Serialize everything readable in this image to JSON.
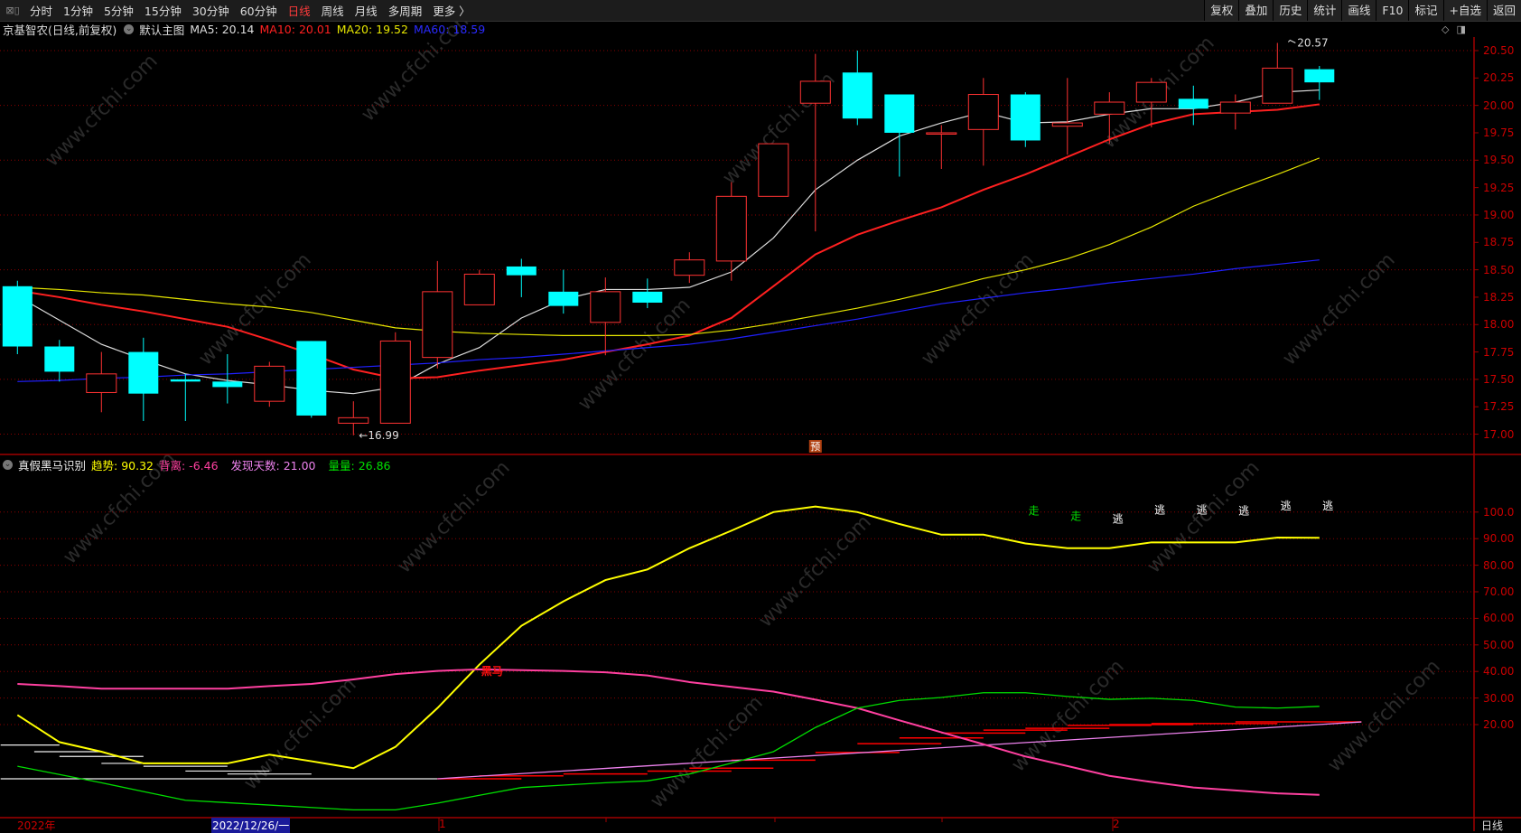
{
  "toolbar": {
    "periods": [
      {
        "label": "分时",
        "active": false
      },
      {
        "label": "1分钟",
        "active": false
      },
      {
        "label": "5分钟",
        "active": false
      },
      {
        "label": "15分钟",
        "active": false
      },
      {
        "label": "30分钟",
        "active": false
      },
      {
        "label": "60分钟",
        "active": false
      },
      {
        "label": "日线",
        "active": true
      },
      {
        "label": "周线",
        "active": false
      },
      {
        "label": "月线",
        "active": false
      },
      {
        "label": "多周期",
        "active": false
      },
      {
        "label": "更多 〉",
        "active": false
      }
    ],
    "buttons": [
      "复权",
      "叠加",
      "历史",
      "统计",
      "画线",
      "F10",
      "标记",
      "+自选",
      "返回"
    ]
  },
  "main_chart": {
    "title": "京基智农(日线,前复权)",
    "template": "默认主图",
    "ma5": "MA5: 20.14",
    "ma10": "MA10: 20.01",
    "ma20": "MA20: 19.52",
    "ma60": "MA60: 18.59",
    "low_label": "←16.99",
    "high_label": "20.57",
    "pre_marker": "预",
    "colors": {
      "up": "#ff3232",
      "down": "#00ffff",
      "ma5": "#dddddd",
      "ma10": "#ff2020",
      "ma20": "#e6e600",
      "ma60": "#2020ff"
    },
    "price_ticks": [
      "20.50",
      "20.25",
      "20.00",
      "19.75",
      "19.50",
      "19.25",
      "19.00",
      "18.75",
      "18.50",
      "18.25",
      "18.00",
      "17.75",
      "17.50",
      "17.25",
      "17.00"
    ]
  },
  "indicator": {
    "name": "真假黑马识别",
    "trend": "趋势: 90.32",
    "divergence": "背离: -6.46",
    "days": "发现天数: 21.00",
    "volume": "量量: 26.86",
    "ticks": [
      "100.0",
      "90.00",
      "80.00",
      "70.00",
      "60.00",
      "50.00",
      "40.00",
      "30.00",
      "20.00"
    ],
    "heima_label": "黑马",
    "signals": [
      {
        "index": 24.2,
        "text": "走",
        "value": 99,
        "color": "#00e000"
      },
      {
        "index": 25.2,
        "text": "走",
        "value": 97,
        "color": "#00e000"
      },
      {
        "index": 26.2,
        "text": "逃",
        "value": 96,
        "color": "#ffffff"
      },
      {
        "index": 27.2,
        "text": "逃",
        "value": 99.5,
        "color": "#ffffff"
      },
      {
        "index": 28.2,
        "text": "逃",
        "value": 99.5,
        "color": "#ffffff"
      },
      {
        "index": 29.2,
        "text": "逃",
        "value": 99,
        "color": "#ffffff"
      },
      {
        "index": 30.2,
        "text": "逃",
        "value": 101,
        "color": "#ffffff"
      },
      {
        "index": 31.2,
        "text": "逃",
        "value": 101,
        "color": "#ffffff"
      }
    ]
  },
  "time_axis": {
    "year": "2022年",
    "cursor_date": "2022/12/26/一",
    "month1": "1",
    "month2": "2",
    "period": "日线"
  },
  "watermark": "www.cfchi.com",
  "chart_data": [
    {
      "type": "candlestick",
      "title": "京基智农(日线,前复权)",
      "ylim": [
        16.9,
        20.6
      ],
      "ohlc": [
        [
          18.35,
          18.4,
          17.73,
          17.8
        ],
        [
          17.8,
          17.86,
          17.48,
          17.57
        ],
        [
          17.38,
          17.75,
          17.2,
          17.55
        ],
        [
          17.75,
          17.88,
          17.12,
          17.37
        ],
        [
          17.5,
          17.55,
          17.12,
          17.48
        ],
        [
          17.48,
          17.73,
          17.28,
          17.43
        ],
        [
          17.3,
          17.66,
          17.25,
          17.62
        ],
        [
          17.85,
          17.85,
          17.15,
          17.17
        ],
        [
          17.1,
          17.3,
          16.99,
          17.15
        ],
        [
          17.1,
          17.93,
          17.1,
          17.85
        ],
        [
          17.7,
          18.58,
          17.6,
          18.3
        ],
        [
          18.18,
          18.5,
          18.18,
          18.46
        ],
        [
          18.53,
          18.6,
          18.25,
          18.45
        ],
        [
          18.3,
          18.5,
          18.1,
          18.17
        ],
        [
          18.02,
          18.43,
          17.72,
          18.3
        ],
        [
          18.3,
          18.42,
          18.15,
          18.2
        ],
        [
          18.45,
          18.66,
          18.38,
          18.59
        ],
        [
          18.58,
          19.3,
          18.4,
          19.17
        ],
        [
          19.17,
          19.65,
          19.17,
          19.65
        ],
        [
          20.02,
          20.47,
          18.85,
          20.22
        ],
        [
          20.3,
          20.5,
          19.82,
          19.88
        ],
        [
          20.1,
          20.1,
          19.35,
          19.75
        ],
        [
          19.74,
          19.82,
          19.42,
          19.75
        ],
        [
          19.78,
          20.25,
          19.45,
          20.1
        ],
        [
          20.1,
          20.12,
          19.62,
          19.68
        ],
        [
          19.81,
          20.25,
          19.55,
          19.84
        ],
        [
          19.92,
          20.12,
          19.65,
          20.03
        ],
        [
          20.03,
          20.25,
          19.8,
          20.21
        ],
        [
          20.06,
          20.18,
          19.82,
          19.97
        ],
        [
          19.93,
          20.1,
          19.78,
          20.03
        ],
        [
          20.02,
          20.57,
          20.02,
          20.34
        ],
        [
          20.33,
          20.36,
          20.05,
          20.21
        ]
      ],
      "series": [
        {
          "name": "MA5",
          "values": [
            18.26,
            18.04,
            17.82,
            17.68,
            17.55,
            17.49,
            17.45,
            17.4,
            17.37,
            17.43,
            17.64,
            17.79,
            18.06,
            18.23,
            18.32,
            18.32,
            18.34,
            18.48,
            18.79,
            19.23,
            19.5,
            19.72,
            19.84,
            19.94,
            19.84,
            19.85,
            19.92,
            19.97,
            19.97,
            20.03,
            20.12,
            20.14
          ]
        },
        {
          "name": "MA10",
          "values": [
            18.31,
            18.25,
            18.18,
            18.12,
            18.05,
            17.98,
            17.86,
            17.73,
            17.59,
            17.51,
            17.52,
            17.58,
            17.63,
            17.68,
            17.75,
            17.82,
            17.9,
            18.06,
            18.35,
            18.64,
            18.82,
            18.95,
            19.07,
            19.23,
            19.37,
            19.53,
            19.69,
            19.83,
            19.92,
            19.94,
            19.96,
            20.01
          ]
        },
        {
          "name": "MA20",
          "values": [
            18.34,
            18.32,
            18.29,
            18.27,
            18.23,
            18.19,
            18.16,
            18.11,
            18.04,
            17.97,
            17.94,
            17.92,
            17.91,
            17.9,
            17.9,
            17.9,
            17.91,
            17.95,
            18.01,
            18.08,
            18.15,
            18.23,
            18.32,
            18.42,
            18.5,
            18.6,
            18.73,
            18.89,
            19.08,
            19.23,
            19.37,
            19.52
          ]
        },
        {
          "name": "MA60",
          "values": [
            17.48,
            17.49,
            17.51,
            17.52,
            17.54,
            17.55,
            17.57,
            17.59,
            17.61,
            17.63,
            17.65,
            17.68,
            17.7,
            17.73,
            17.76,
            17.79,
            17.82,
            17.87,
            17.93,
            17.99,
            18.05,
            18.12,
            18.19,
            18.24,
            18.29,
            18.33,
            18.38,
            18.42,
            18.46,
            18.51,
            18.55,
            18.59
          ]
        }
      ]
    },
    {
      "type": "line",
      "title": "真假黑马识别",
      "ylim": [
        -15,
        105
      ],
      "series": [
        {
          "name": "趋势",
          "color": "#ffff00",
          "values": [
            23.6,
            13.4,
            9.8,
            5.4,
            5.4,
            5.4,
            8.7,
            6.2,
            3.6,
            11.6,
            26.2,
            42.6,
            57.2,
            66.4,
            74.4,
            78.4,
            86.4,
            93.0,
            100.0,
            102.1,
            100.0,
            95.5,
            91.5,
            91.5,
            88.2,
            86.4,
            86.4,
            88.6,
            88.6,
            88.6,
            90.4,
            90.32
          ]
        },
        {
          "name": "背离",
          "color": "#ff40a0",
          "values": [
            35.3,
            34.5,
            33.5,
            33.5,
            33.5,
            33.5,
            34.5,
            35.3,
            37.0,
            39.0,
            40.2,
            40.8,
            40.5,
            40.2,
            39.7,
            38.5,
            36.0,
            34.2,
            32.4,
            29.4,
            26.2,
            21.6,
            17.1,
            12.6,
            8.0,
            4.4,
            0.7,
            -1.6,
            -3.7,
            -4.8,
            -5.9,
            -6.46
          ]
        },
        {
          "name": "量量",
          "color": "#00dd00",
          "values": [
            4.3,
            1.2,
            -1.9,
            -5.2,
            -8.5,
            -9.4,
            -10.3,
            -11.2,
            -12.1,
            -12.1,
            -9.6,
            -6.6,
            -3.7,
            -2.8,
            -1.9,
            -1.2,
            1.4,
            5.5,
            9.8,
            18.9,
            26.2,
            29.1,
            30.2,
            32.0,
            32.0,
            30.6,
            29.5,
            29.9,
            29.1,
            26.6,
            26.2,
            26.86
          ]
        },
        {
          "name": "发现天数",
          "color": "#ee82ee",
          "start_index": 10,
          "start": -0.4,
          "end_index": 32,
          "end": 21.0
        }
      ],
      "white_steps": [
        {
          "from": -0.4,
          "to": 1,
          "v": 12.3
        },
        {
          "from": 0.4,
          "to": 2,
          "v": 9.8
        },
        {
          "from": 1,
          "to": 3,
          "v": 8.0
        },
        {
          "from": 2,
          "to": 4,
          "v": 5.4
        },
        {
          "from": 3,
          "to": 5,
          "v": 4.3
        },
        {
          "from": 4,
          "to": 6,
          "v": 2.5
        },
        {
          "from": 5,
          "to": 7,
          "v": 1.4
        },
        {
          "from": -0.4,
          "to": 10,
          "v": -0.4
        }
      ],
      "red_steps": [
        {
          "from": 10,
          "to": 12,
          "v": -0.4
        },
        {
          "from": 11,
          "to": 13,
          "v": 0.7
        },
        {
          "from": 13,
          "to": 15,
          "v": 1.4
        },
        {
          "from": 15,
          "to": 17,
          "v": 2.5
        },
        {
          "from": 16,
          "to": 18,
          "v": 3.6
        },
        {
          "from": 17,
          "to": 19,
          "v": 6.6
        },
        {
          "from": 19,
          "to": 21,
          "v": 9.5
        },
        {
          "from": 20,
          "to": 22,
          "v": 12.8
        },
        {
          "from": 21,
          "to": 23,
          "v": 15.0
        },
        {
          "from": 22,
          "to": 24,
          "v": 16.8
        },
        {
          "from": 23,
          "to": 25,
          "v": 17.9
        },
        {
          "from": 24,
          "to": 26,
          "v": 18.6
        },
        {
          "from": 25,
          "to": 27,
          "v": 19.7
        },
        {
          "from": 26,
          "to": 28,
          "v": 20.0
        },
        {
          "from": 27,
          "to": 30,
          "v": 20.4
        },
        {
          "from": 29,
          "to": 32,
          "v": 21.0
        }
      ],
      "heima_index": 11.3,
      "heima_value": 40
    }
  ]
}
